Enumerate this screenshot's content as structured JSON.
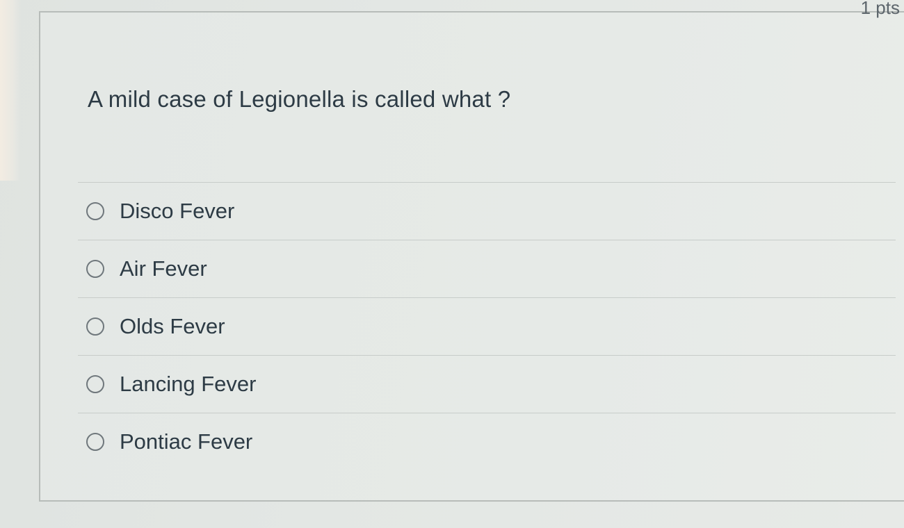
{
  "header": {
    "points_text": "1 pts"
  },
  "question": {
    "text": "A mild case of Legionella is called what ?"
  },
  "answers": [
    {
      "label": "Disco Fever",
      "selected": false
    },
    {
      "label": "Air Fever",
      "selected": false
    },
    {
      "label": "Olds Fever",
      "selected": false
    },
    {
      "label": "Lancing Fever",
      "selected": false
    },
    {
      "label": "Pontiac Fever",
      "selected": false
    }
  ],
  "colors": {
    "text": "#2d3b45",
    "divider": "#c7ccc9",
    "radio_border": "#6f777c"
  }
}
